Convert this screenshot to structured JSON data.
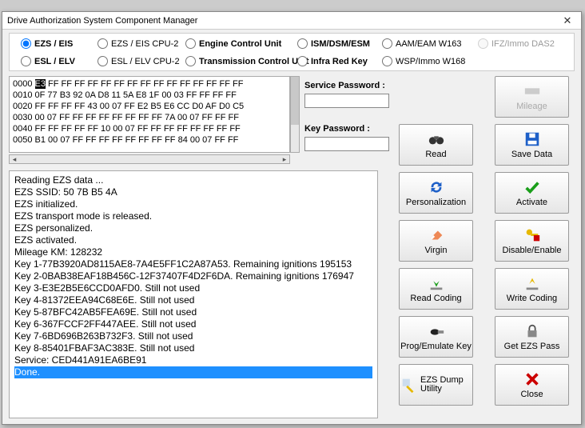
{
  "titlebar": {
    "title": "Drive Authorization System Component Manager"
  },
  "radios": {
    "ezs_eis": "EZS / EIS",
    "ezs_eis_cpu2": "EZS / EIS CPU-2",
    "ecu": "Engine Control Unit",
    "ism": "ISM/DSM/ESM",
    "aam": "AAM/EAM W163",
    "ifz": "IFZ/Immo DAS2",
    "esl_elv": "ESL / ELV",
    "esl_elv_cpu2": "ESL / ELV CPU-2",
    "tcu": "Transmission Control Unit",
    "irk": "Infra Red Key",
    "wsp": "WSP/Immo W168"
  },
  "hex_lines": [
    "0000 E3 FF FF FF FF FF FF FF FF FF FF FF FF FF FF FF",
    "0010 0F 77 B3 92 0A D8 11 5A E8 1F 00 03 FF FF FF FF",
    "0020 FF FF FF FF 43 00 07 FF E2 B5 E6 CC D0 AF D0 C5",
    "0030 00 07 FF FF FF FF FF FF FF FF 7A 00 07 FF FF FF",
    "0040 FF FF FF FF FF 10 00 07 FF FF FF FF FF FF FF FF",
    "0050 B1 00 07 FF FF FF FF FF FF FF FF 84 00 07 FF FF"
  ],
  "pw": {
    "service_label": "Service Password :",
    "key_label": "Key Password :",
    "service_value": "",
    "key_value": ""
  },
  "log_lines": [
    "Reading EZS data ...",
    "EZS SSID: 50 7B B5 4A",
    "EZS initialized.",
    "EZS transport mode is released.",
    "EZS personalized.",
    "EZS activated.",
    "Mileage KM: 128232",
    "Key 1-77B3920AD8115AE8-7A4E5FF1C2A87A53. Remaining ignitions 195153",
    "Key 2-0BAB38EAF18B456C-12F37407F4D2F6DA. Remaining ignitions 176947",
    "Key 3-E3E2B5E6CCD0AFD0. Still not used",
    "Key 4-81372EEA94C68E6E. Still not used",
    "Key 5-87BFC42AB5FEA69E. Still not used",
    "Key 6-367FCCF2FF447AEE. Still not used",
    "Key 7-6BD696B263B732F3. Still not used",
    "Key 8-85401FBAF3AC383E. Still not used",
    "Service: CED441A91EA6BE91"
  ],
  "log_done": "Done.",
  "buttons": {
    "mileage": "Mileage",
    "read": "Read",
    "save": "Save Data",
    "personalization": "Personalization",
    "activate": "Activate",
    "virgin": "Virgin",
    "disable_enable": "Disable/Enable",
    "read_coding": "Read Coding",
    "write_coding": "Write Coding",
    "prog_key": "Prog/Emulate Key",
    "get_ezs_pass": "Get EZS Pass",
    "ezs_dump": "EZS Dump Utility",
    "close": "Close"
  }
}
